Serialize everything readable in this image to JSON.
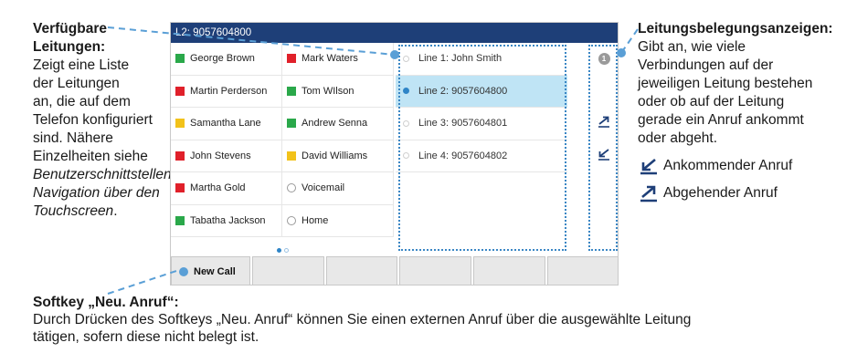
{
  "annotations": {
    "left": {
      "heading_line1": "Verfügbare",
      "heading_line2": "Leitungen:",
      "text_lines": [
        "Zeigt eine Liste",
        "der Leitungen",
        "an, die auf dem",
        "Telefon konfiguriert",
        "sind. Nähere",
        "Einzelheiten siehe"
      ],
      "italic_lines": [
        "Benutzerschnittstellen-",
        "Navigation über den",
        "Touchscreen"
      ],
      "tail": "."
    },
    "right": {
      "heading": "Leitungsbelegungsanzeigen:",
      "text_lines": [
        "Gibt an, wie viele",
        "Verbindungen auf der",
        "jeweiligen Leitung bestehen",
        "oder ob auf der Leitung",
        "gerade ein Anruf ankommt",
        "oder abgeht."
      ],
      "incoming_label": "Ankommender Anruf",
      "outgoing_label": "Abgehender Anruf"
    },
    "bottom": {
      "heading": "Softkey „Neu. Anruf“:",
      "text_line1": "Durch Drücken des Softkeys „Neu. Anruf“ können Sie einen externen Anruf über die ausgewählte Leitung",
      "text_line2": "tätigen, sofern diese nicht belegt ist."
    }
  },
  "screen": {
    "title": "L2: 9057604800",
    "contacts": [
      {
        "left": {
          "name": "George Brown",
          "color": "#2aa84a",
          "marker": "square"
        },
        "right": {
          "name": "Mark Waters",
          "color": "#e0202a",
          "marker": "square"
        }
      },
      {
        "left": {
          "name": "Martin Perderson",
          "color": "#e0202a",
          "marker": "square"
        },
        "right": {
          "name": "Tom WIlson",
          "color": "#2aa84a",
          "marker": "square"
        }
      },
      {
        "left": {
          "name": "Samantha Lane",
          "color": "#f2c21a",
          "marker": "square"
        },
        "right": {
          "name": "Andrew Senna",
          "color": "#2aa84a",
          "marker": "square"
        }
      },
      {
        "left": {
          "name": "John Stevens",
          "color": "#e0202a",
          "marker": "square"
        },
        "right": {
          "name": "David Williams",
          "color": "#f2c21a",
          "marker": "square"
        }
      },
      {
        "left": {
          "name": "Martha Gold",
          "color": "#e0202a",
          "marker": "square"
        },
        "right": {
          "name": "Voicemail",
          "color": "#9a9a9a",
          "marker": "ring"
        }
      },
      {
        "left": {
          "name": "Tabatha Jackson",
          "color": "#2aa84a",
          "marker": "square"
        },
        "right": {
          "name": "Home",
          "color": "#9a9a9a",
          "marker": "ring"
        }
      }
    ],
    "pager": {
      "active_color": "#2e84c7",
      "inactive_color": "#bcd6ec"
    },
    "lines": [
      {
        "label": "Line 1: John Smith",
        "selected": false
      },
      {
        "label": "Line 2: 9057604800",
        "selected": true
      },
      {
        "label": "Line 3: 9057604801",
        "selected": false
      },
      {
        "label": "Line 4: 9057604802",
        "selected": false
      }
    ],
    "indicators": [
      {
        "type": "badge",
        "value": "1"
      },
      {
        "type": "none"
      },
      {
        "type": "outgoing-arrow-icon"
      },
      {
        "type": "incoming-arrow-icon"
      }
    ],
    "softkeys": [
      "New Call",
      "",
      "",
      "",
      "",
      ""
    ]
  },
  "colors": {
    "titlebar": "#1e3f78",
    "selected_line": "#bfe4f5",
    "callout_blue": "#3a86c4"
  }
}
